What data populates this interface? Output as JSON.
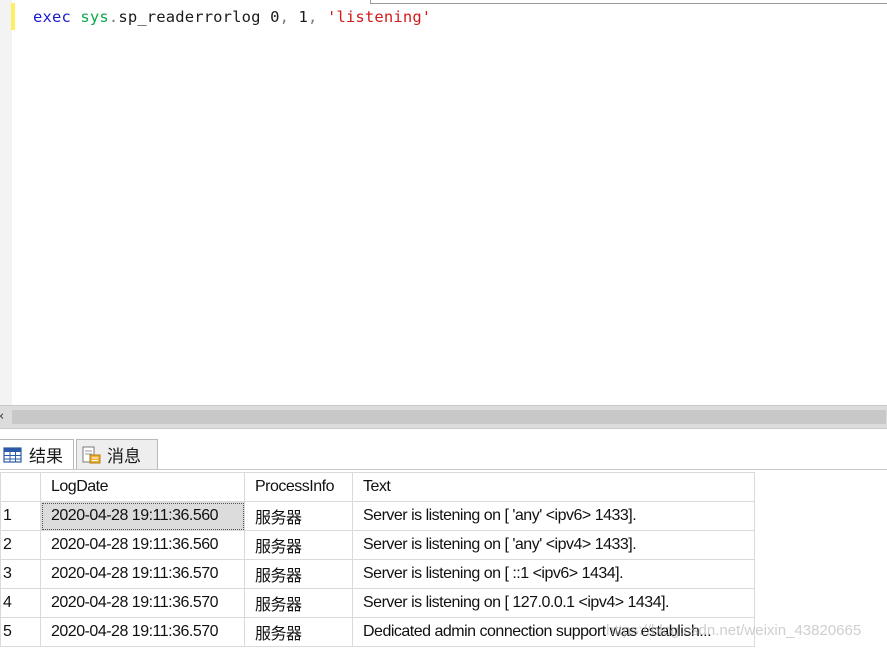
{
  "editor": {
    "code": {
      "keyword": "exec",
      "schema": "sys",
      "dot": ".",
      "proc_name": "sp_readerrorlog",
      "arg1": "0",
      "comma1": ",",
      "arg2": "1",
      "comma2": ",",
      "arg3": "'listening'"
    }
  },
  "tabs": [
    {
      "label": "结果",
      "icon": "grid-icon",
      "active": true
    },
    {
      "label": "消息",
      "icon": "message-icon",
      "active": false
    }
  ],
  "grid": {
    "columns": [
      "LogDate",
      "ProcessInfo",
      "Text"
    ],
    "rows": [
      {
        "n": "1",
        "date": "2020-04-28 19:11:36.560",
        "proc": "服务器",
        "text": "Server is listening on [ 'any' <ipv6> 1433]."
      },
      {
        "n": "2",
        "date": "2020-04-28 19:11:36.560",
        "proc": "服务器",
        "text": "Server is listening on [ 'any' <ipv4> 1433]."
      },
      {
        "n": "3",
        "date": "2020-04-28 19:11:36.570",
        "proc": "服务器",
        "text": "Server is listening on [ ::1 <ipv6> 1434]."
      },
      {
        "n": "4",
        "date": "2020-04-28 19:11:36.570",
        "proc": "服务器",
        "text": "Server is listening on [ 127.0.0.1 <ipv4> 1434]."
      },
      {
        "n": "5",
        "date": "2020-04-28 19:11:36.570",
        "proc": "服务器",
        "text": "Dedicated admin connection support was establish..."
      }
    ]
  },
  "watermark": "https://blog.csdn.net/weixin_43820665",
  "colors": {
    "keyword": "#1b1bcf",
    "system": "#0aa84a",
    "string": "#d21a1a",
    "change_bar": "#ffee62"
  }
}
